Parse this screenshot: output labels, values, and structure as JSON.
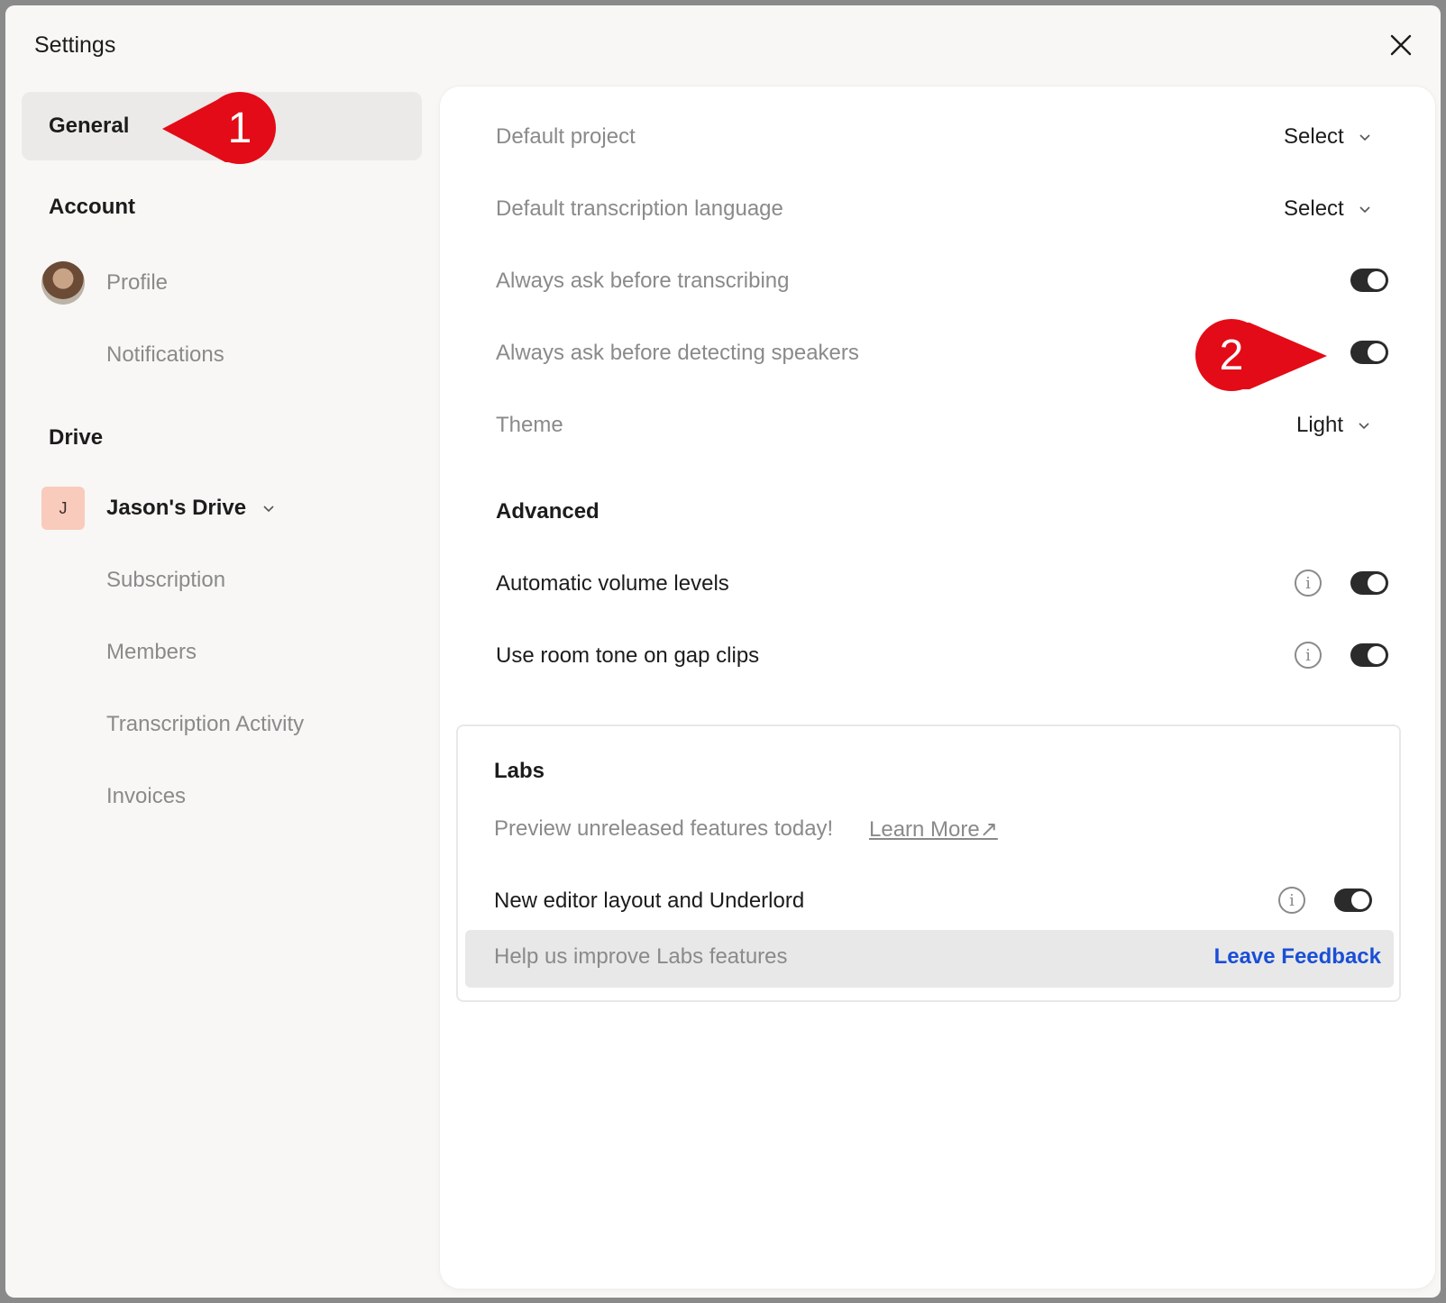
{
  "window": {
    "title": "Settings"
  },
  "sidebar": {
    "general": "General",
    "account_heading": "Account",
    "profile": "Profile",
    "notifications": "Notifications",
    "drive_heading": "Drive",
    "drive_badge": "J",
    "drive_name": "Jason's Drive",
    "subscription": "Subscription",
    "members": "Members",
    "transcription_activity": "Transcription Activity",
    "invoices": "Invoices"
  },
  "general": {
    "default_project": {
      "label": "Default project",
      "value": "Select"
    },
    "default_language": {
      "label": "Default transcription language",
      "value": "Select"
    },
    "ask_transcribing": {
      "label": "Always ask before transcribing",
      "on": true
    },
    "ask_speakers": {
      "label": "Always ask before detecting speakers",
      "on": true
    },
    "theme": {
      "label": "Theme",
      "value": "Light"
    }
  },
  "advanced": {
    "heading": "Advanced",
    "auto_volume": {
      "label": "Automatic volume levels",
      "on": true
    },
    "room_tone": {
      "label": "Use room tone on gap clips",
      "on": true
    }
  },
  "labs": {
    "heading": "Labs",
    "preview_text": "Preview unreleased features today!",
    "learn_more": "Learn More↗",
    "new_editor": {
      "label": "New editor layout and Underlord",
      "on": true
    },
    "help_text": "Help us improve Labs features",
    "feedback_link": "Leave Feedback"
  },
  "annotations": {
    "first": "1",
    "second": "2"
  },
  "colors": {
    "accent_link": "#1a4fd6",
    "callout": "#e30b17",
    "toggle_on": "#2b2b2b"
  },
  "info_glyph": "i"
}
